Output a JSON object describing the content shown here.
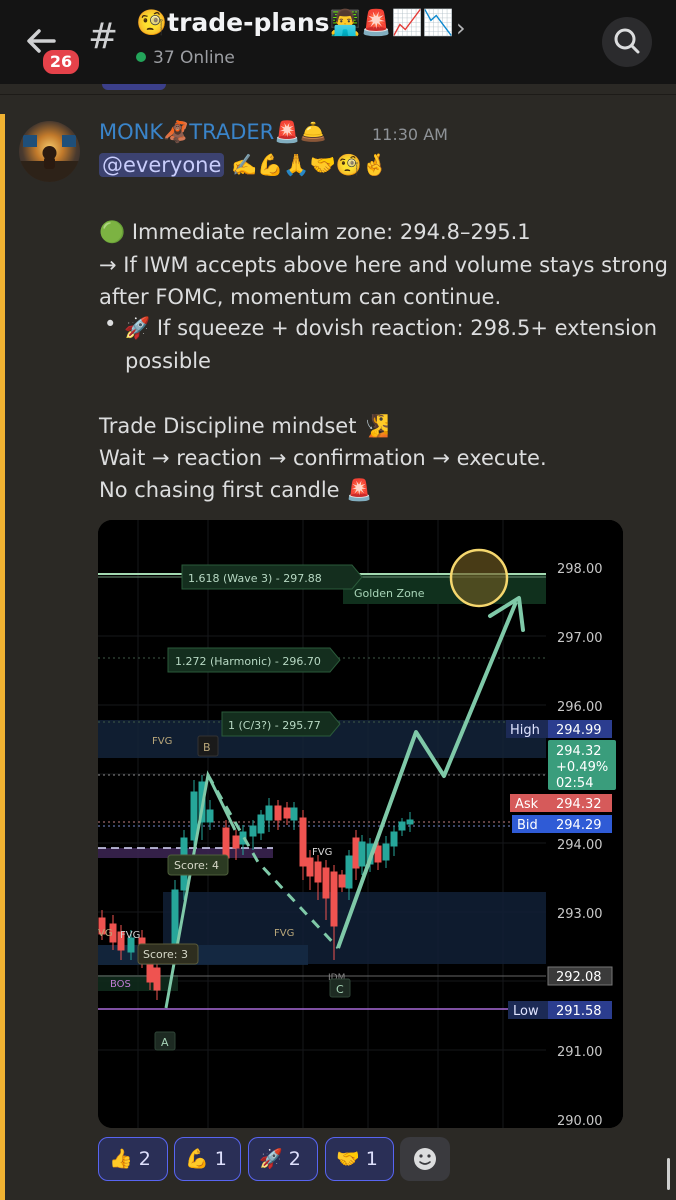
{
  "header": {
    "badge_count": "26",
    "hash_symbol": "#",
    "channel_name": "🧐trade-plans👨‍💻🚨📈📉",
    "chevron": "›",
    "online_text": "37 Online"
  },
  "message": {
    "username": "MONK🦧TRADER🚨🛎️",
    "timestamp": "11:30 AM",
    "mention": "@everyone",
    "mention_emojis": "✍️💪🙏🤝🧐🤞",
    "lines": [
      "🟢 Immediate reclaim zone: 294.8–295.1",
      "→ If IWM accepts above here and volume stays strong",
      "after FOMC, momentum can continue.",
      "🚀 If squeeze + dovish reaction: 298.5+ extension",
      "possible",
      "Trade Discipline mindset 🧏",
      "Wait → reaction → confirmation → execute.",
      "No chasing first candle 🚨"
    ],
    "bullet": "•"
  },
  "chart": {
    "price_ticks": [
      "298.00",
      "297.00",
      "296.00",
      "294.00",
      "293.00",
      "291.00",
      "290.00"
    ],
    "fib_labels": [
      "1.618 (Wave 3) - 297.88",
      "1.272 (Harmonic) - 296.70",
      "1 (C/3?) - 295.77"
    ],
    "golden_zone": "Golden Zone",
    "high_label": "High",
    "high_value": "294.99",
    "last_price": "294.32",
    "last_change": "+0.49%",
    "last_countdown": "02:54",
    "ask_label": "Ask",
    "ask_value": "294.32",
    "bid_label": "Bid",
    "bid_value": "294.29",
    "level_value": "292.08",
    "low_label": "Low",
    "low_value": "291.58",
    "fvg_label": "FVG",
    "fvg_left": "VG",
    "score4": "Score: 4",
    "score3": "Score: 3",
    "bos": "BOS",
    "idm": "IDM",
    "pt_a": "A",
    "pt_b": "B",
    "pt_c": "C",
    "colors": {
      "up": "#26a69a",
      "down": "#ef5350",
      "arrow": "#7fc9a8",
      "golden": "#f5d76e"
    }
  },
  "reactions": [
    {
      "emoji": "👍",
      "count": "2"
    },
    {
      "emoji": "💪",
      "count": "1"
    },
    {
      "emoji": "🚀",
      "count": "2"
    },
    {
      "emoji": "🤝",
      "count": "1"
    }
  ]
}
